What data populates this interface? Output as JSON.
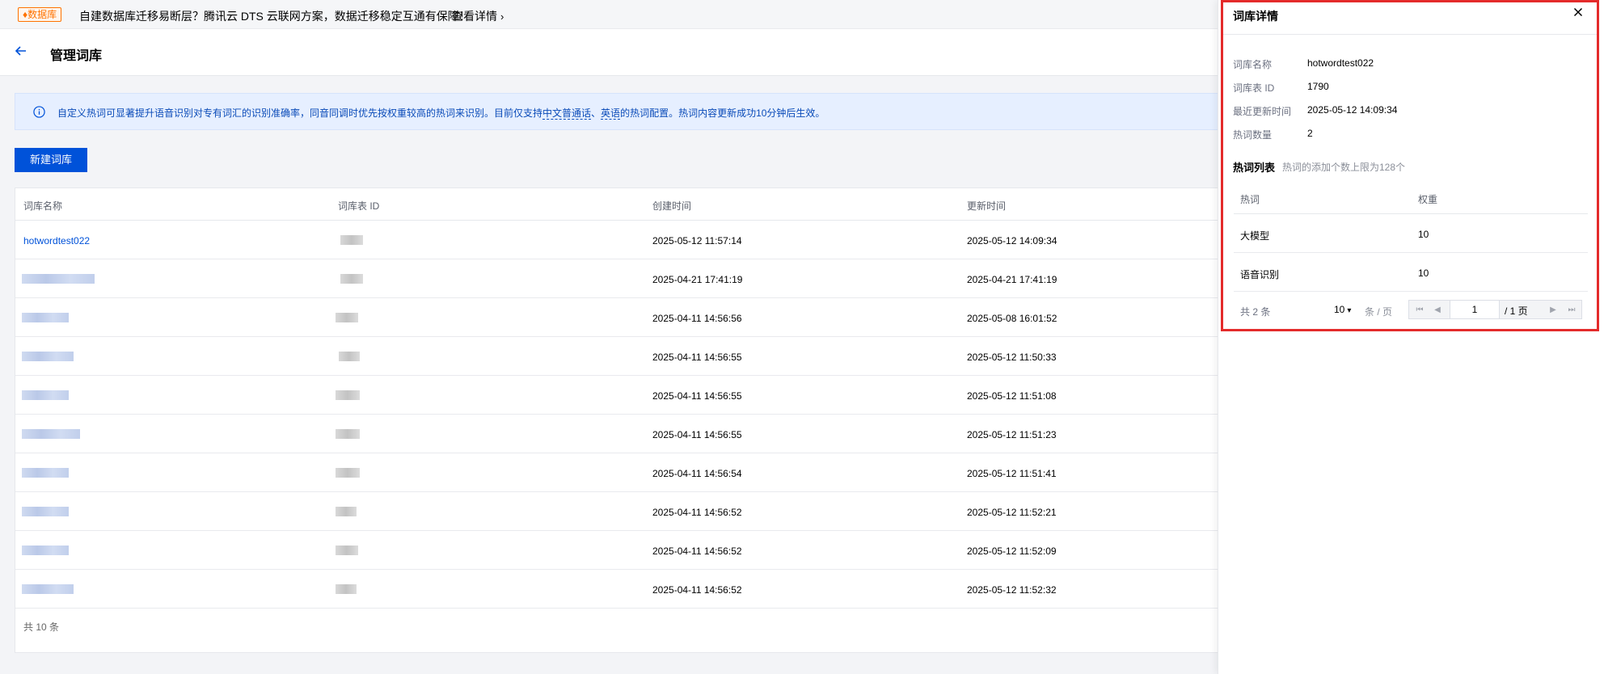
{
  "banner": {
    "tag": "♦数据库",
    "text": "自建数据库迁移易断层？腾讯云 DTS 云联网方案，数据迁移稳定互通有保障！",
    "link": "查看详情"
  },
  "header": {
    "title": "管理词库"
  },
  "notice": {
    "text_1": "自定义热词可显著提升语音识别对专有词汇的识别准确率，同音同调时优先按权重较高的热词来识别。目前仅支持",
    "lang_zh": "中文普通话",
    "sep": "、",
    "lang_en": "英语",
    "text_2": "的热词配置。热词内容更新成功10分钟后生效。"
  },
  "actions": {
    "create_label": "新建词库"
  },
  "table": {
    "columns": [
      "词库名称",
      "词库表 ID",
      "创建时间",
      "更新时间"
    ],
    "rows": [
      {
        "name": "hotwordtest022",
        "created": "2025-05-12 11:57:14",
        "updated": "2025-05-12 14:09:34"
      },
      {
        "name": "",
        "created": "2025-04-21 17:41:19",
        "updated": "2025-04-21 17:41:19"
      },
      {
        "name": "",
        "created": "2025-04-11 14:56:56",
        "updated": "2025-05-08 16:01:52"
      },
      {
        "name": "",
        "created": "2025-04-11 14:56:55",
        "updated": "2025-05-12 11:50:33"
      },
      {
        "name": "",
        "created": "2025-04-11 14:56:55",
        "updated": "2025-05-12 11:51:08"
      },
      {
        "name": "",
        "created": "2025-04-11 14:56:55",
        "updated": "2025-05-12 11:51:23"
      },
      {
        "name": "",
        "created": "2025-04-11 14:56:54",
        "updated": "2025-05-12 11:51:41"
      },
      {
        "name": "",
        "created": "2025-04-11 14:56:52",
        "updated": "2025-05-12 11:52:21"
      },
      {
        "name": "",
        "created": "2025-04-11 14:56:52",
        "updated": "2025-05-12 11:52:09"
      },
      {
        "name": "",
        "created": "2025-04-11 14:56:52",
        "updated": "2025-05-12 11:52:32"
      }
    ],
    "footer": "共 10 条"
  },
  "panel": {
    "title": "词库详情",
    "fields": [
      {
        "label": "词库名称",
        "value": "hotwordtest022"
      },
      {
        "label": "词库表 ID",
        "value": "1790"
      },
      {
        "label": "最近更新时间",
        "value": "2025-05-12 14:09:34"
      },
      {
        "label": "热词数量",
        "value": "2"
      }
    ],
    "hotwords": {
      "title": "热词列表",
      "hint": "热词的添加个数上限为128个",
      "columns": [
        "热词",
        "权重"
      ],
      "rows": [
        {
          "word": "大模型",
          "weight": "10"
        },
        {
          "word": "语音识别",
          "weight": "10"
        }
      ]
    },
    "pagination": {
      "total": "共 2 条",
      "page_size": "10",
      "unit": "条 / 页",
      "current": "1",
      "of": "/ 1 页"
    }
  },
  "colors": {
    "primary": "#0052d9",
    "highlight": "#e42b2b",
    "notice_bg": "#e6efff",
    "banner_tag": "#ff7200"
  },
  "icons": {
    "back": "arrow-left-icon",
    "info": "info-circle-icon",
    "close": "close-icon"
  }
}
